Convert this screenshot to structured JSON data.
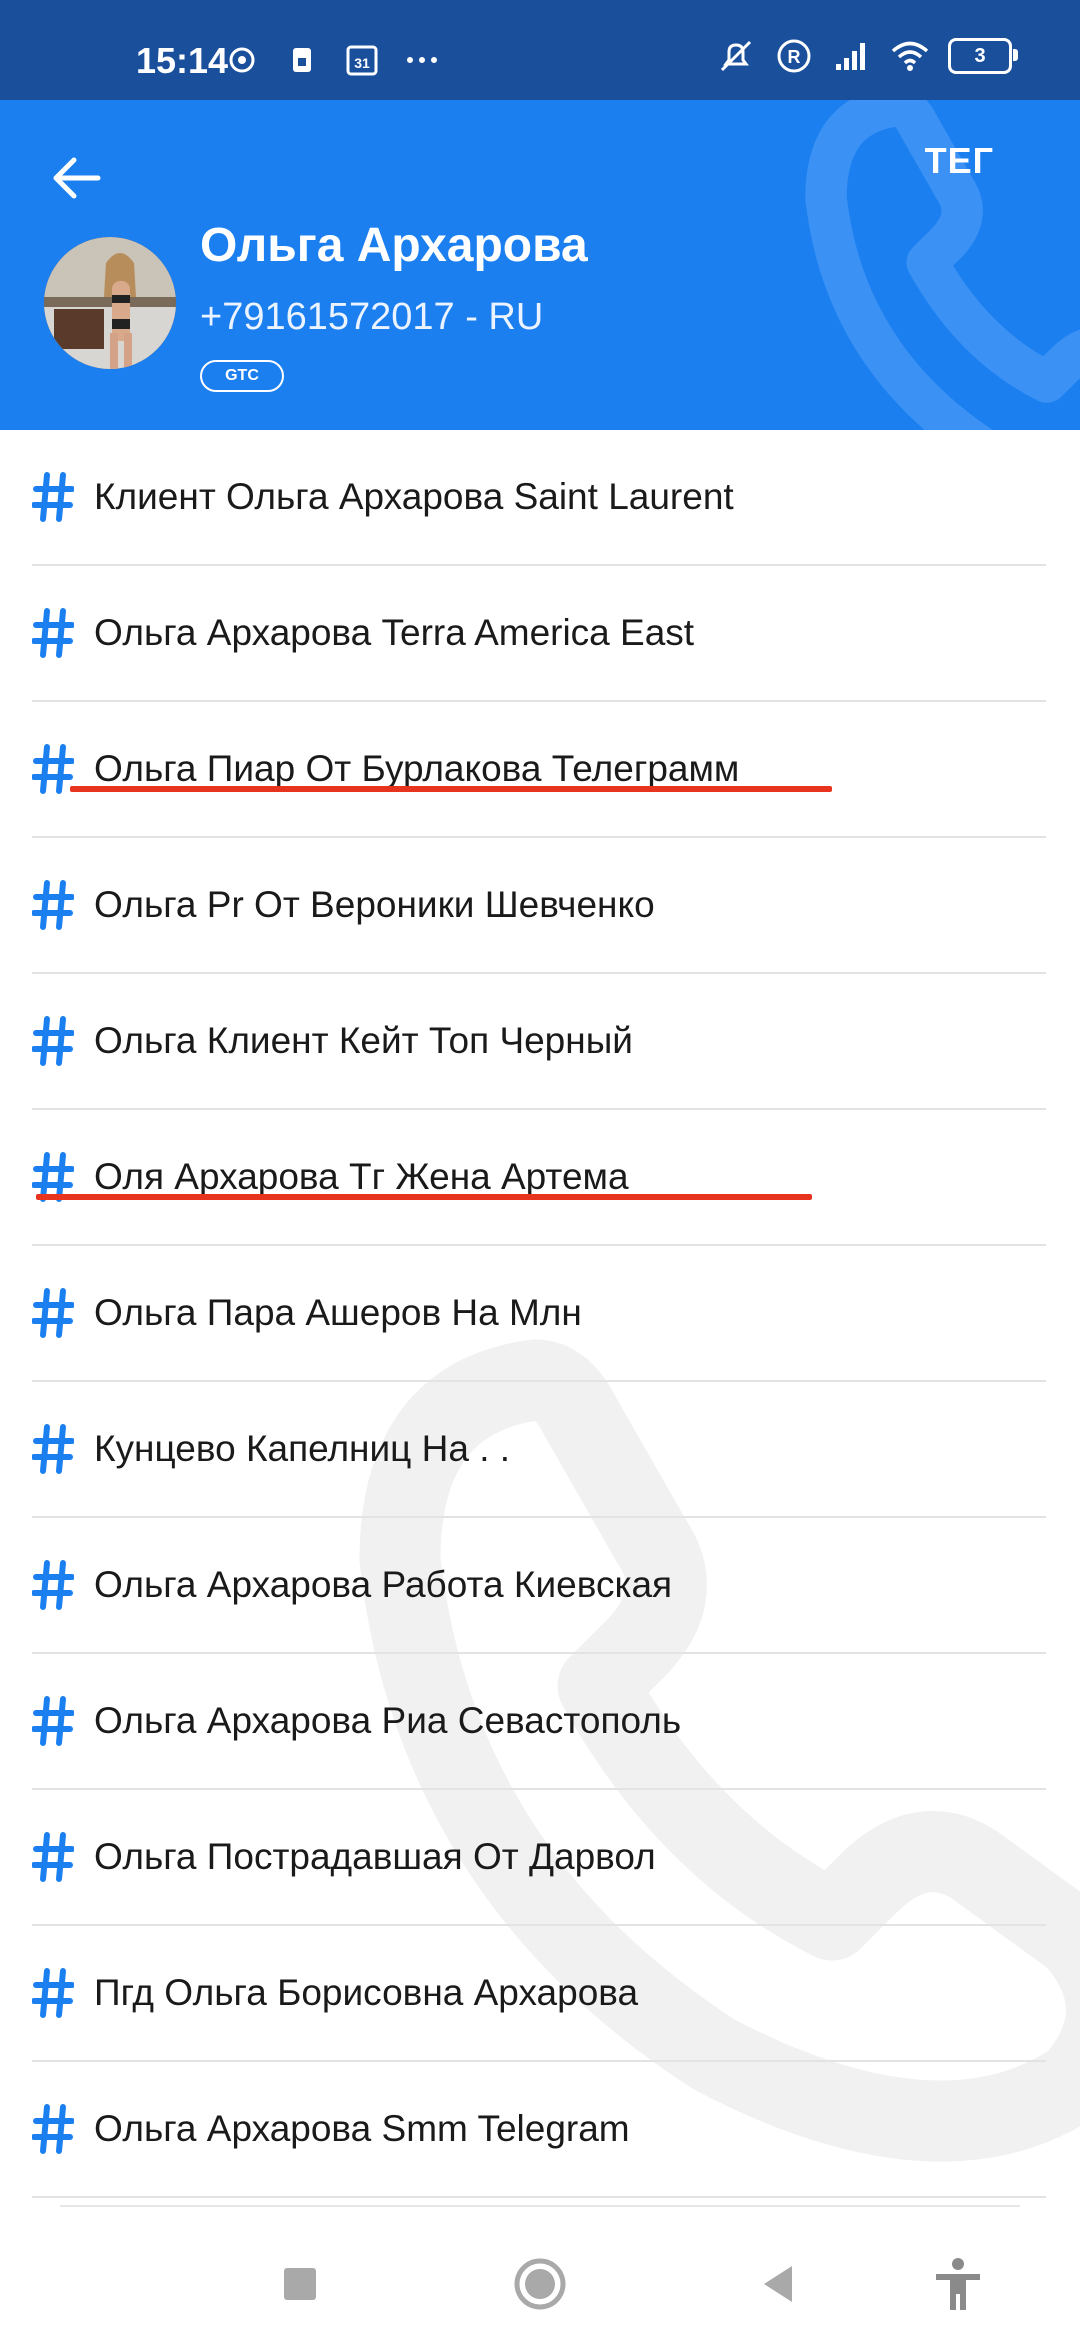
{
  "status_bar": {
    "time": "15:14",
    "battery": "3",
    "icons": [
      "gear-icon",
      "sim-icon",
      "calendar-icon",
      "more-dots-icon",
      "muted-icon",
      "registered-icon",
      "signal-icon",
      "wifi-icon",
      "battery-icon"
    ]
  },
  "header": {
    "tag_button": "ТЕГ",
    "name": "Ольга Архарова",
    "phone": "+79161572017 - RU",
    "badge": "GTC",
    "accent_color": "#1b7ff0"
  },
  "tags": [
    {
      "label": "Клиент Ольга Архарова Saint Laurent"
    },
    {
      "label": "Ольга Архарова Terra America East"
    },
    {
      "label": "Ольга Пиар От Бурлакова Телеграмм",
      "underlined": true
    },
    {
      "label": "Ольга Pr От Вероники Шевченко"
    },
    {
      "label": "Ольга Клиент Кейт Топ Черный"
    },
    {
      "label": "Оля Архарова Тг Жена Артема",
      "underlined": true
    },
    {
      "label": "Ольга Пара Ашеров На Млн"
    },
    {
      "label": "Кунцево Капелниц На . ."
    },
    {
      "label": "Ольга Архарова Работа Киевская"
    },
    {
      "label": "Ольга Архарова Риа Севастополь"
    },
    {
      "label": "Ольга Пострадавшая От Дарвол"
    },
    {
      "label": "Пгд Ольга Борисовна Архарова"
    },
    {
      "label": "Ольга Архарова Smm Telegram"
    }
  ],
  "underline_color": "#e8331f",
  "nav": [
    "recents-icon",
    "home-icon",
    "back-icon",
    "accessibility-icon"
  ]
}
